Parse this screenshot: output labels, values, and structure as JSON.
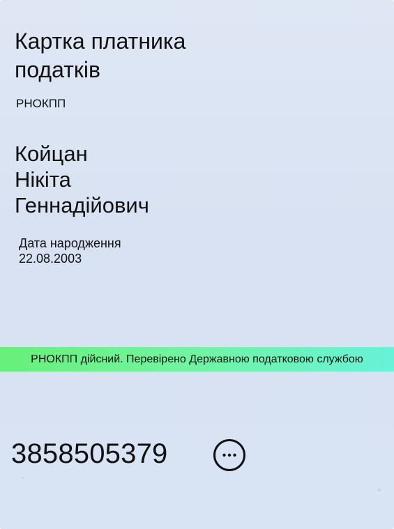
{
  "card": {
    "title": "Картка платника\nподатків",
    "id_label": "РНОКПП",
    "name": "Койцан\nНікіта\nГеннадійович",
    "birth_date_label": "Дата народження",
    "birth_date_value": "22.08.2003",
    "status_text": "РНОКПП дійсний. Перевірено Державною податковою службою",
    "tax_number": "3858505379",
    "more_icon_name": "more-options-icon"
  },
  "colors": {
    "card_background": "#d9e3f3",
    "text": "#111111",
    "status_gradient_start": "#67f07a",
    "status_gradient_end": "#68f2d8",
    "icon_stroke": "#111111"
  }
}
